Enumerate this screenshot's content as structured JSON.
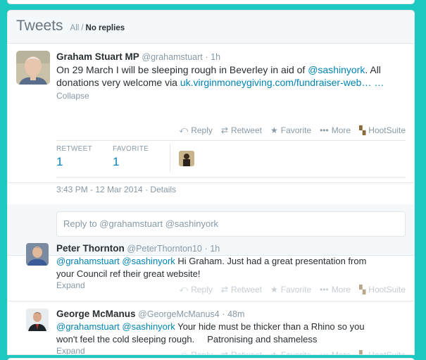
{
  "header": {
    "title": "Tweets",
    "filter_all": "All",
    "filter_sep": "/",
    "filter_active": "No replies"
  },
  "main_tweet": {
    "fullname": "Graham Stuart MP",
    "username": "@grahamstuart",
    "dot": "·",
    "time": "1h",
    "text_pre": "On 29 March I will be sleeping rough in Beverley in aid of ",
    "mention": "@sashinyork",
    "text_mid": ". All donations very welcome via ",
    "link": "uk.virginmoneygiving.com/fundraiser-web… …",
    "toggle": "Collapse",
    "actions": {
      "reply": "Reply",
      "retweet": "Retweet",
      "favorite": "Favorite",
      "more": "More",
      "hootsuite": "HootSuite"
    },
    "stats": {
      "retweet_label": "RETWEET",
      "retweet_count": "1",
      "favorite_label": "FAVORITE",
      "favorite_count": "1"
    },
    "timestamp": "3:43 PM - 12 Mar 2014",
    "meta_dot": "·",
    "details": "Details"
  },
  "reply_box": {
    "placeholder": "Reply to @grahamstuart @sashinyork"
  },
  "replies": [
    {
      "fullname": "Peter Thornton",
      "username": "@PeterThornton10",
      "dot": "·",
      "time": "1h",
      "mentions": "@grahamstuart @sashinyork",
      "text_line1": " Hi Graham. Just had a great presentation from",
      "text_line2": "your Council ref their great website!",
      "toggle": "Expand"
    },
    {
      "fullname": "George McManus",
      "username": "@GeorgeMcManus4",
      "dot": "·",
      "time": "48m",
      "mentions": "@grahamstuart @sashinyork",
      "text_line1": " Your hide must be thicker than a Rhino so you",
      "text_line2": "won't feel the cold sleeping rough.     Patronising and shameless",
      "toggle": "Expand"
    }
  ],
  "reply_actions": {
    "reply": "Reply",
    "retweet": "Retweet",
    "favorite": "Favorite",
    "more": "More",
    "hootsuite": "HootSuite"
  },
  "colors": {
    "background": "#1dc8c0",
    "link": "#0084b4",
    "muted": "#8899a6"
  }
}
